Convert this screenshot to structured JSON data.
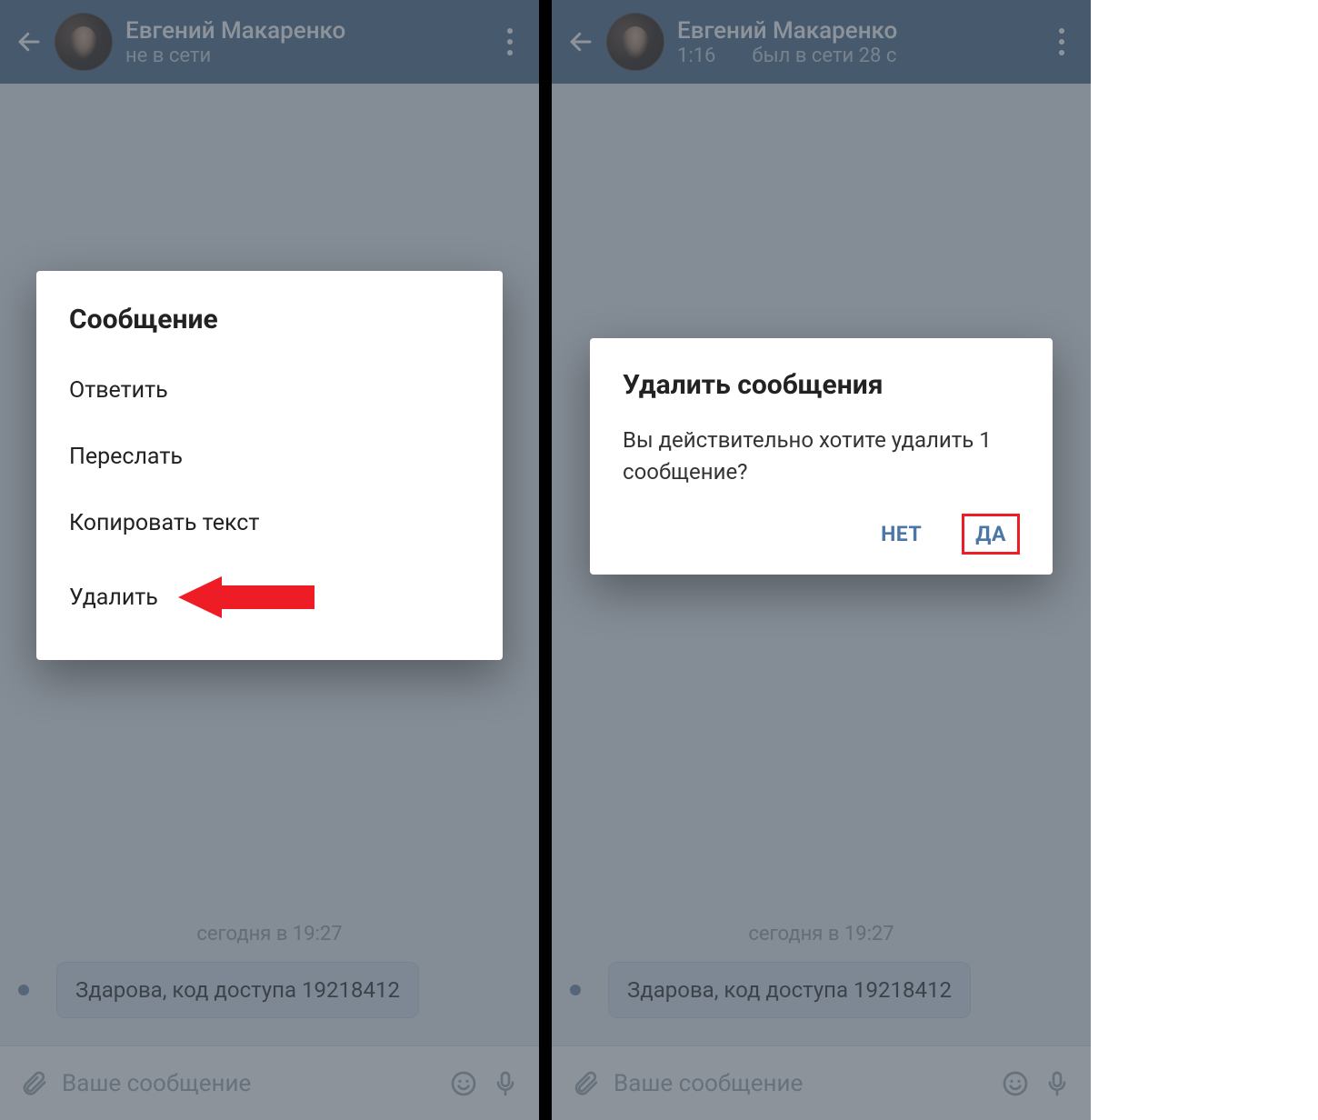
{
  "left": {
    "header": {
      "name": "Евгений Макаренко",
      "status": "не в сети"
    },
    "date_separator": "сегодня в 19:27",
    "message": "Здарова, код доступа 19218412",
    "composer_placeholder": "Ваше сообщение",
    "menu": {
      "title": "Сообщение",
      "reply": "Ответить",
      "forward": "Переслать",
      "copy": "Копировать текст",
      "delete": "Удалить"
    }
  },
  "right": {
    "header": {
      "name": "Евгений Макаренко",
      "time": "1:16",
      "last_seen": "был в сети 28 с"
    },
    "date_separator": "сегодня в 19:27",
    "message": "Здарова, код доступа 19218412",
    "composer_placeholder": "Ваше сообщение",
    "dialog": {
      "title": "Удалить сообщения",
      "body": "Вы действительно хотите удалить 1 сообщение?",
      "no": "НЕТ",
      "yes": "ДА"
    }
  }
}
